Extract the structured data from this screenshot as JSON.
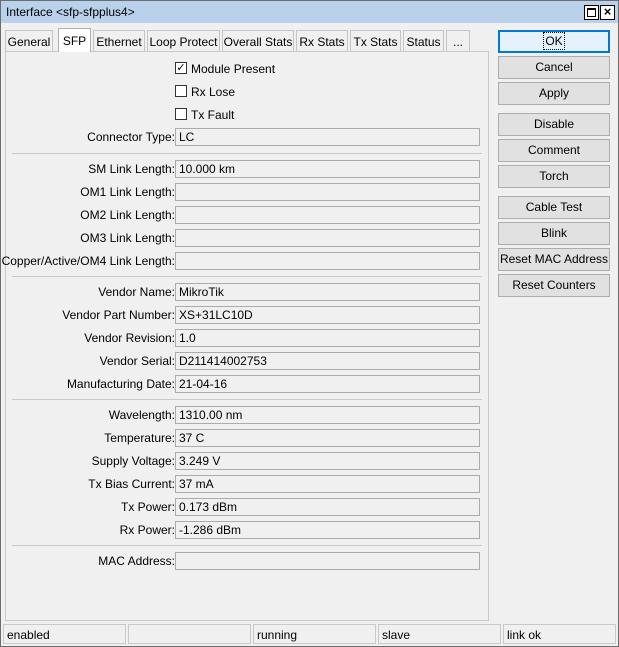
{
  "window": {
    "title": "Interface <sfp-sfpplus4>"
  },
  "tabs": [
    "General",
    "SFP",
    "Ethernet",
    "Loop Protect",
    "Overall Stats",
    "Rx Stats",
    "Tx Stats",
    "Status",
    "..."
  ],
  "active_tab": "SFP",
  "checkboxes": [
    {
      "label": "Module Present",
      "checked": true
    },
    {
      "label": "Rx Lose",
      "checked": false
    },
    {
      "label": "Tx Fault",
      "checked": false
    }
  ],
  "fields": {
    "connector_type": {
      "label": "Connector Type:",
      "value": "LC"
    },
    "sm_link_length": {
      "label": "SM Link Length:",
      "value": "10.000 km"
    },
    "om1_link_length": {
      "label": "OM1 Link Length:",
      "value": ""
    },
    "om2_link_length": {
      "label": "OM2 Link Length:",
      "value": ""
    },
    "om3_link_length": {
      "label": "OM3 Link Length:",
      "value": ""
    },
    "copper_link_length": {
      "label": "Copper/Active/OM4 Link Length:",
      "value": ""
    },
    "vendor_name": {
      "label": "Vendor Name:",
      "value": "MikroTik"
    },
    "vendor_part_number": {
      "label": "Vendor Part Number:",
      "value": "XS+31LC10D"
    },
    "vendor_revision": {
      "label": "Vendor Revision:",
      "value": "1.0"
    },
    "vendor_serial": {
      "label": "Vendor Serial:",
      "value": "D211414002753"
    },
    "manufacturing_date": {
      "label": "Manufacturing Date:",
      "value": "21-04-16"
    },
    "wavelength": {
      "label": "Wavelength:",
      "value": "1310.00 nm"
    },
    "temperature": {
      "label": "Temperature:",
      "value": "37 C"
    },
    "supply_voltage": {
      "label": "Supply Voltage:",
      "value": "3.249 V"
    },
    "tx_bias_current": {
      "label": "Tx Bias Current:",
      "value": "37 mA"
    },
    "tx_power": {
      "label": "Tx Power:",
      "value": "0.173 dBm"
    },
    "rx_power": {
      "label": "Rx Power:",
      "value": "-1.286 dBm"
    },
    "mac_address": {
      "label": "MAC Address:",
      "value": ""
    }
  },
  "buttons": {
    "ok": "OK",
    "cancel": "Cancel",
    "apply": "Apply",
    "disable": "Disable",
    "comment": "Comment",
    "torch": "Torch",
    "cable_test": "Cable Test",
    "blink": "Blink",
    "reset_mac": "Reset MAC Address",
    "reset_counters": "Reset Counters"
  },
  "status_bar": [
    "enabled",
    "",
    "running",
    "slave",
    "link ok"
  ]
}
